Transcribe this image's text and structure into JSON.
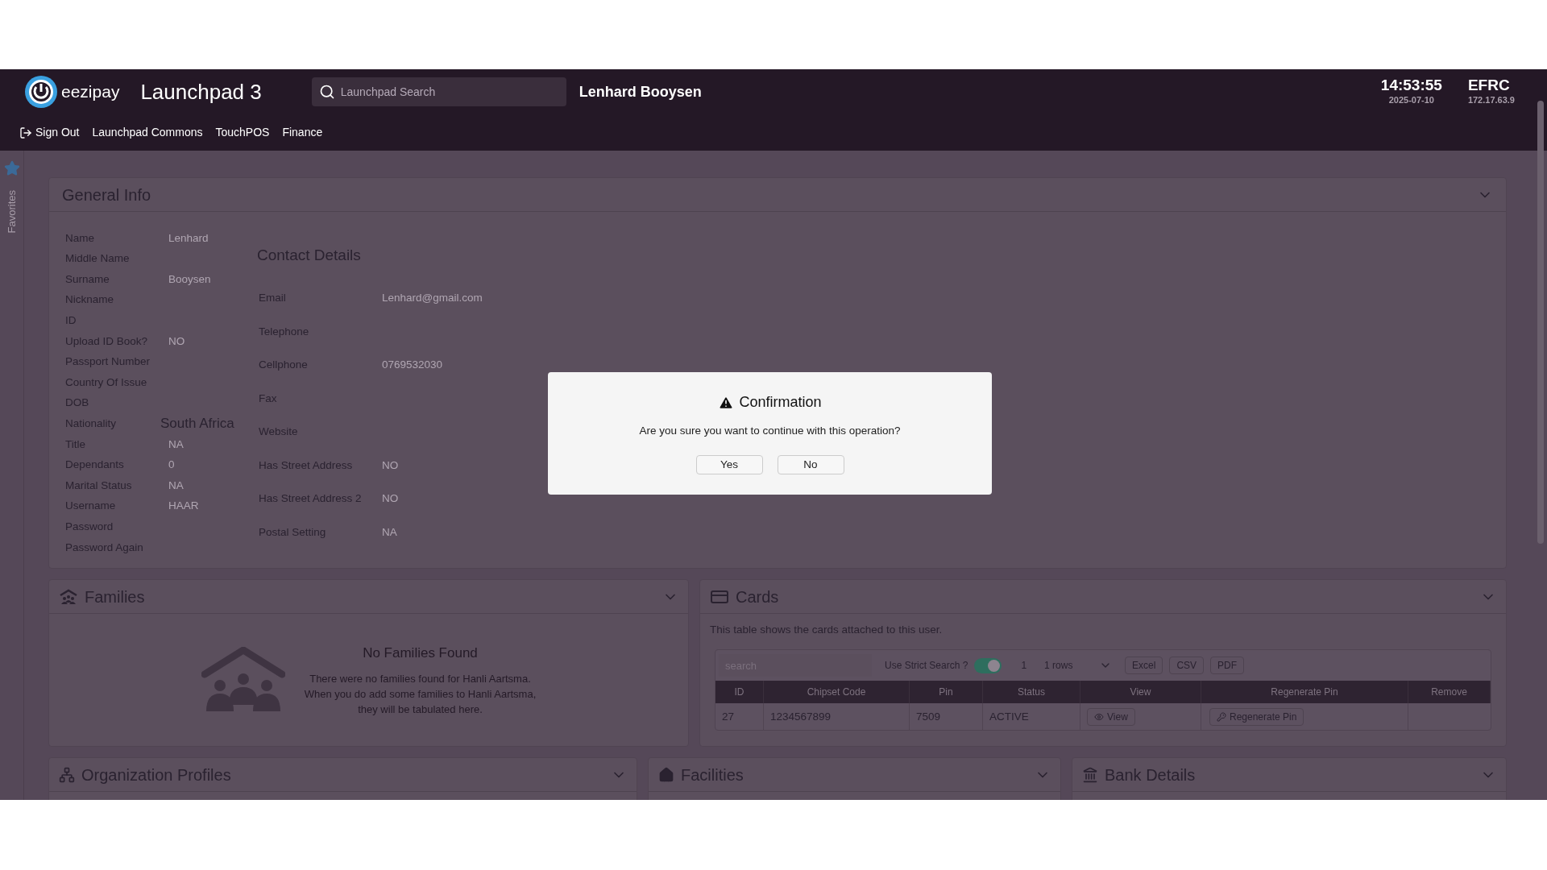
{
  "header": {
    "logo_text": "eezipay",
    "app_title": "Launchpad 3",
    "search": {
      "placeholder": "Launchpad Search"
    },
    "user": "Lenhard Booysen",
    "time": "14:53:55",
    "date": "2025-07-10",
    "site": "EFRC",
    "ip": "172.17.63.9"
  },
  "nav": [
    {
      "label": "Sign Out",
      "kind": "signout"
    },
    {
      "label": "Launchpad Commons",
      "kind": "link"
    },
    {
      "label": "TouchPOS",
      "kind": "link"
    },
    {
      "label": "Finance",
      "kind": "link"
    }
  ],
  "sidebar": {
    "label": "Favorites"
  },
  "general_info": {
    "title": "General Info",
    "fields": [
      {
        "label": "Name",
        "value": "Lenhard",
        "kind": "plain"
      },
      {
        "label": "Middle Name",
        "kind": "plain"
      },
      {
        "label": "Surname",
        "value": "Booysen",
        "kind": "plain"
      },
      {
        "label": "Nickname",
        "kind": "plain"
      },
      {
        "label": "ID",
        "kind": "plain"
      },
      {
        "label": "Upload ID Book?",
        "value": "NO",
        "kind": "plain"
      },
      {
        "label": "Passport Number",
        "kind": "plain"
      },
      {
        "label": "Country Of Issue",
        "kind": "plain"
      },
      {
        "label": "DOB",
        "kind": "plain"
      },
      {
        "label": "Nationality",
        "value": "South Africa",
        "kind": "select"
      },
      {
        "label": "Title",
        "value": "NA",
        "kind": "plain"
      },
      {
        "label": "Dependants",
        "value": "0",
        "kind": "plain"
      },
      {
        "label": "Marital Status",
        "value": "NA",
        "kind": "plain"
      },
      {
        "label": "Username",
        "value": "HAAR",
        "kind": "plain"
      },
      {
        "label": "Password",
        "kind": "plain"
      },
      {
        "label": "Password Again",
        "kind": "plain"
      }
    ],
    "contact": {
      "title": "Contact Details",
      "fields": [
        {
          "label": "Email",
          "value": "Lenhard@gmail.com"
        },
        {
          "label": "Telephone"
        },
        {
          "label": "Cellphone",
          "value": "0769532030"
        },
        {
          "label": "Fax"
        },
        {
          "label": "Website"
        },
        {
          "label": "Has Street Address",
          "value": "NO"
        },
        {
          "label": "Has Street Address 2",
          "value": "NO"
        },
        {
          "label": "Postal Setting",
          "value": "NA"
        }
      ]
    }
  },
  "families": {
    "title": "Families",
    "empty_title": "No Families Found",
    "empty_message": [
      "There were no families found for Hanli Aartsma.",
      "When you do add some families to Hanli Aartsma,",
      "they will be tabulated here."
    ]
  },
  "cards": {
    "title": "Cards",
    "description": "This table shows the cards attached to this user.",
    "search": {
      "placeholder": "search"
    },
    "strict_search": {
      "label": "Use Strict Search ?",
      "on": true
    },
    "count": "1",
    "rows_select": "1 rows",
    "exports": [
      "Excel",
      "CSV",
      "PDF"
    ],
    "columns": [
      "ID",
      "Chipset Code",
      "Pin",
      "Status",
      "View",
      "Regenerate Pin",
      "Remove"
    ],
    "rows": [
      {
        "cells": [
          "27",
          "1234567899",
          "7509",
          "ACTIVE"
        ],
        "view": "View",
        "regenerate": "Regenerate Pin"
      }
    ]
  },
  "bottom_panels": [
    {
      "title": "Organization Profiles",
      "kind": "org"
    },
    {
      "title": "Facilities",
      "kind": "home"
    },
    {
      "title": "Bank Details",
      "kind": "bank"
    }
  ],
  "dialog": {
    "title": "Confirmation",
    "message": "Are you sure you want to continue with this operation?",
    "buttons": [
      "Yes",
      "No"
    ]
  }
}
